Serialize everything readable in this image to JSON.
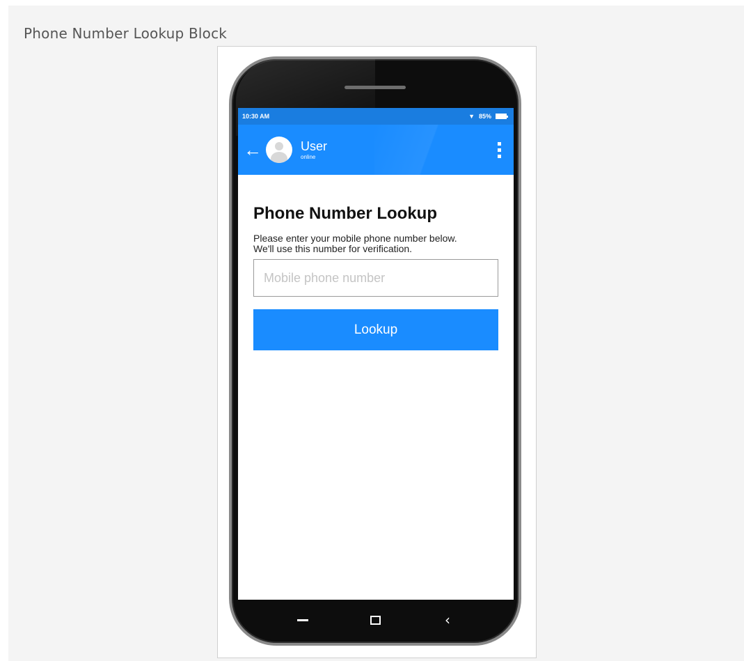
{
  "caption": "Phone Number Lookup Block",
  "statusbar": {
    "time": "10:30 AM",
    "battery_text": "85%"
  },
  "appbar": {
    "user_name": "User",
    "user_status": "online"
  },
  "content": {
    "title": "Phone Number Lookup",
    "description_line1": "Please enter your mobile phone number below.",
    "description_line2": "We'll use this number for verification.",
    "phone_placeholder": "Mobile phone number",
    "phone_value": "",
    "lookup_label": "Lookup"
  },
  "icons": {
    "back": "arrow-left-icon",
    "avatar": "user-avatar-icon",
    "menu": "more-vertical-icon",
    "wifi": "wifi-icon",
    "battery": "battery-icon",
    "nav_recent": "minus-icon",
    "nav_home": "square-icon",
    "nav_back": "chevron-left-icon"
  },
  "colors": {
    "accent": "#1a8cff",
    "statusbar": "#1a7de0",
    "background": "#f4f4f4"
  }
}
